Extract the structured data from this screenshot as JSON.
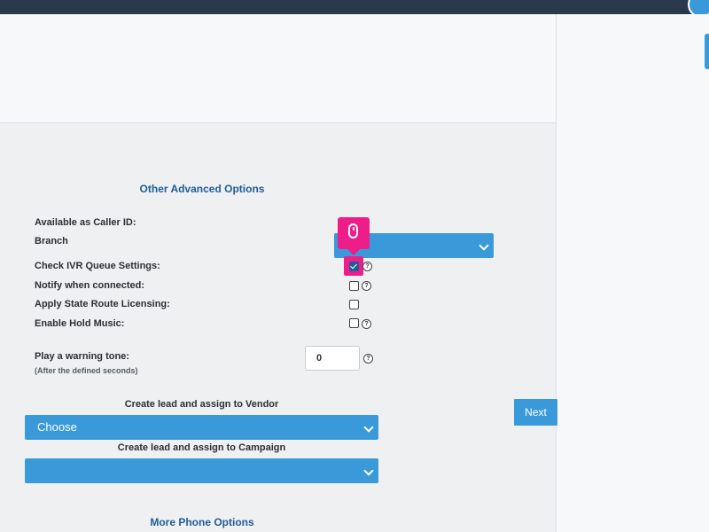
{
  "sections": {
    "other_advanced_options": "Other Advanced Options",
    "more_phone_options": "More Phone Options"
  },
  "fields": {
    "available_as_caller_id": "Available as Caller ID:",
    "branch": "Branch",
    "check_ivr_queue_settings": "Check IVR Queue Settings:",
    "notify_when_connected": "Notify when connected:",
    "apply_state_route_licensing": "Apply State Route Licensing:",
    "enable_hold_music": "Enable Hold Music:",
    "play_warning_tone": "Play a warning tone:",
    "play_warning_tone_hint": "(After the defined seconds)",
    "warning_tone_value": "0"
  },
  "checkboxes": {
    "check_ivr_queue_settings": true,
    "notify_when_connected": false,
    "apply_state_route_licensing": false,
    "enable_hold_music": false
  },
  "vendor": {
    "label": "Create lead and assign to Vendor",
    "selected": "Choose"
  },
  "campaign": {
    "label": "Create lead and assign to Campaign",
    "selected": ""
  },
  "buttons": {
    "next": "Next"
  },
  "help_glyph": "?",
  "colors": {
    "accent": "#3a9ad9",
    "section_title": "#1f5d95",
    "cursor_highlight": "#ee1d8a",
    "topbar": "#2b3a4b"
  }
}
